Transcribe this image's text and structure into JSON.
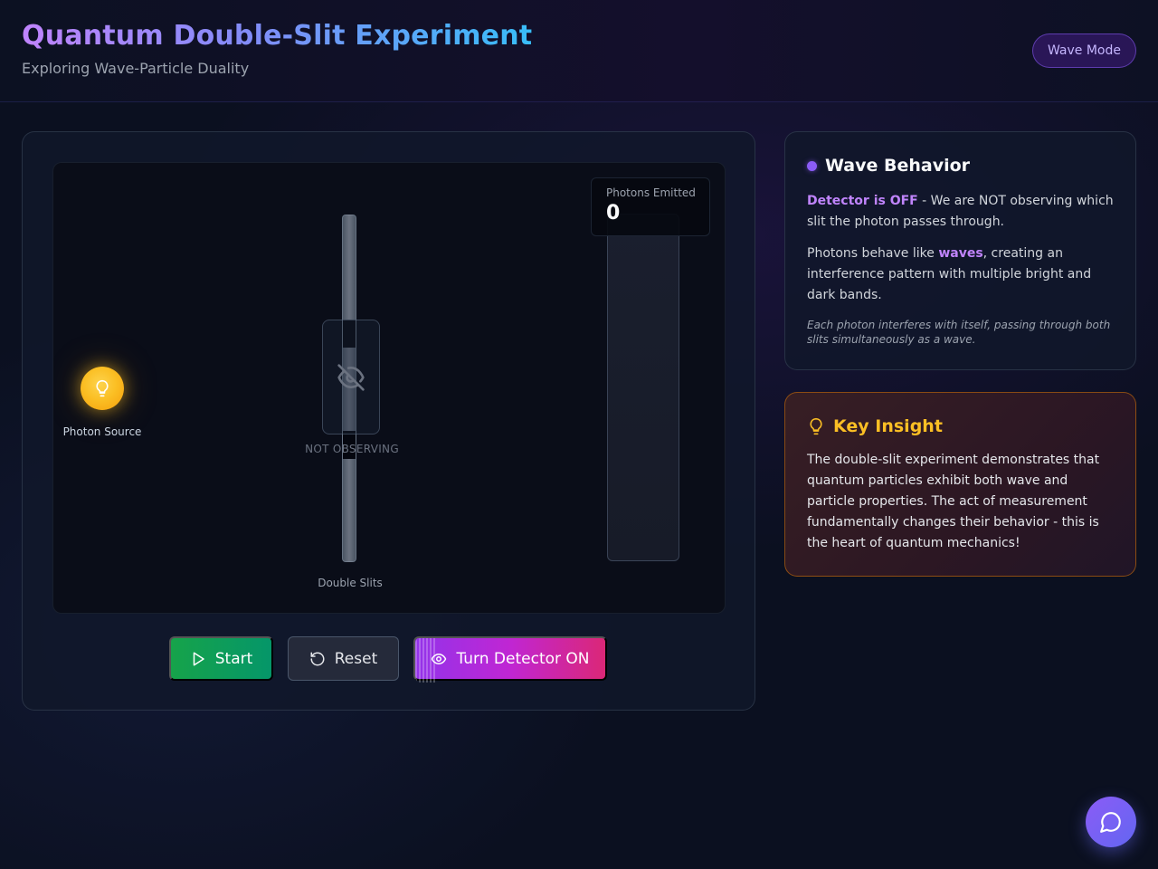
{
  "header": {
    "title": "Quantum Double-Slit Experiment",
    "subtitle": "Exploring Wave-Particle Duality",
    "mode_badge": "Wave Mode"
  },
  "simulation": {
    "source_label": "Photon Source",
    "slits_label": "Double Slits",
    "observer_label": "NOT OBSERVING",
    "counter": {
      "label": "Photons Emitted",
      "value": "0"
    }
  },
  "controls": {
    "start_label": "Start",
    "reset_label": "Reset",
    "detector_label": "Turn Detector ON"
  },
  "info": {
    "title": "Wave Behavior",
    "detector_status": "Detector is OFF",
    "paragraph1_rest": " - We are NOT observing which slit the photon passes through.",
    "paragraph2_pre": "Photons behave like ",
    "paragraph2_highlight": "waves",
    "paragraph2_post": ", creating an interference pattern with multiple bright and dark bands.",
    "note": "Each photon interferes with itself, passing through both slits simultaneously as a wave."
  },
  "insight": {
    "title": "Key Insight",
    "text": "The double-slit experiment demonstrates that quantum particles exhibit both wave and particle properties. The act of measurement fundamentally changes their behavior - this is the heart of quantum mechanics!"
  },
  "icons": {
    "source": "lightbulb-icon",
    "detector": "eye-off-icon",
    "start": "play-icon",
    "reset": "rotate-ccw-icon",
    "detector_button": "eye-icon",
    "insight": "lightbulb-icon",
    "chat": "message-circle-icon"
  },
  "colors": {
    "accent_purple": "#8b5cf6",
    "start_green": "#16a34a",
    "insight_amber": "#fbbf24",
    "source_gold": "#fbbf24"
  }
}
